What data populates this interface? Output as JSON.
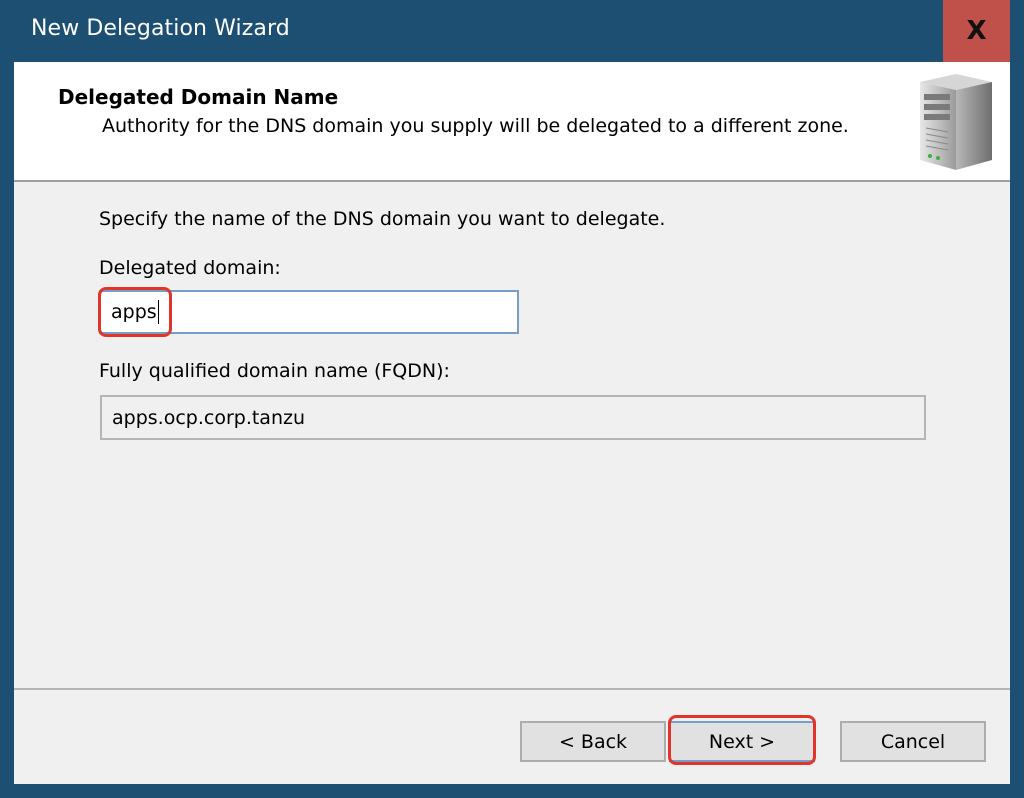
{
  "window": {
    "title": "New Delegation Wizard",
    "close_label": "X"
  },
  "header": {
    "title": "Delegated Domain Name",
    "subtitle": "Authority for the DNS domain you supply will be delegated to a different zone.",
    "icon": "server-icon"
  },
  "body": {
    "prompt": "Specify the name of the DNS domain you want to delegate.",
    "delegated_label": "Delegated domain:",
    "delegated_value": "apps",
    "fqdn_label": "Fully qualified domain name (FQDN):",
    "fqdn_value": "apps.ocp.corp.tanzu"
  },
  "buttons": {
    "back": "< Back",
    "next": "Next >",
    "cancel": "Cancel"
  },
  "colors": {
    "titlebar": "#1c4f72",
    "close": "#c0504a",
    "highlight": "#e0352b"
  }
}
